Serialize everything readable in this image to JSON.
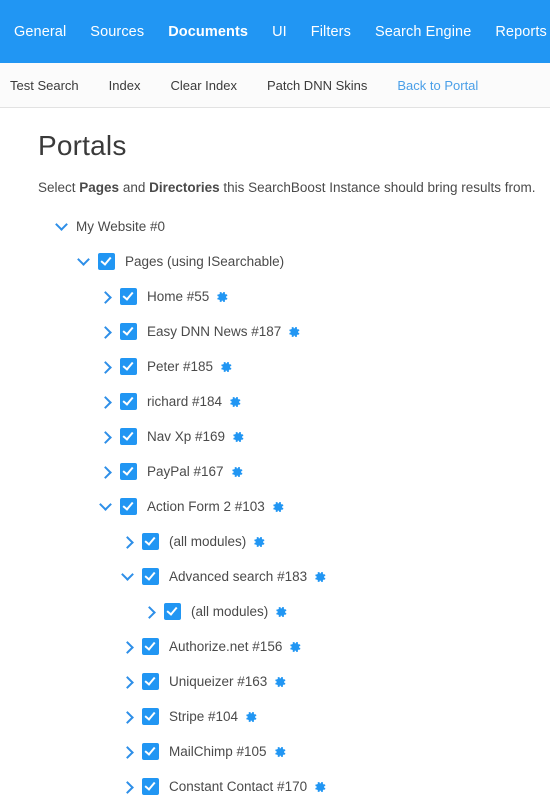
{
  "nav": {
    "items": [
      {
        "label": "General",
        "active": false
      },
      {
        "label": "Sources",
        "active": false
      },
      {
        "label": "Documents",
        "active": true
      },
      {
        "label": "UI",
        "active": false
      },
      {
        "label": "Filters",
        "active": false
      },
      {
        "label": "Search Engine",
        "active": false
      },
      {
        "label": "Reports",
        "active": false
      }
    ]
  },
  "toolbar": {
    "items": [
      {
        "label": "Test Search",
        "link": false
      },
      {
        "label": "Index",
        "link": false
      },
      {
        "label": "Clear Index",
        "link": false
      },
      {
        "label": "Patch DNN Skins",
        "link": false
      },
      {
        "label": "Back to Portal",
        "link": true
      }
    ]
  },
  "page": {
    "title": "Portals",
    "description_parts": [
      {
        "text": "Select ",
        "bold": false
      },
      {
        "text": "Pages",
        "bold": true
      },
      {
        "text": " and ",
        "bold": false
      },
      {
        "text": "Directories",
        "bold": true
      },
      {
        "text": " this SearchBoost Instance should bring results from.",
        "bold": false
      }
    ]
  },
  "colors": {
    "accent": "#2196f3",
    "nav_bg": "#2196f3",
    "link": "#4a9fe8",
    "text": "#4a4a4a",
    "toolbar_bg": "#fbfbfb"
  },
  "tree": {
    "nodes": [
      {
        "label": "My Website #0",
        "level": 0,
        "chevron": "down",
        "checkbox": false,
        "checked": false,
        "gear": false
      },
      {
        "label": "Pages (using ISearchable)",
        "level": 1,
        "chevron": "down",
        "checkbox": true,
        "checked": true,
        "gear": false
      },
      {
        "label": "Home #55",
        "level": 2,
        "chevron": "right",
        "checkbox": true,
        "checked": true,
        "gear": true
      },
      {
        "label": "Easy DNN News #187",
        "level": 2,
        "chevron": "right",
        "checkbox": true,
        "checked": true,
        "gear": true
      },
      {
        "label": "Peter #185",
        "level": 2,
        "chevron": "right",
        "checkbox": true,
        "checked": true,
        "gear": true
      },
      {
        "label": "richard #184",
        "level": 2,
        "chevron": "right",
        "checkbox": true,
        "checked": true,
        "gear": true
      },
      {
        "label": "Nav Xp #169",
        "level": 2,
        "chevron": "right",
        "checkbox": true,
        "checked": true,
        "gear": true
      },
      {
        "label": "PayPal #167",
        "level": 2,
        "chevron": "right",
        "checkbox": true,
        "checked": true,
        "gear": true
      },
      {
        "label": "Action Form 2 #103",
        "level": 2,
        "chevron": "down",
        "checkbox": true,
        "checked": true,
        "gear": true
      },
      {
        "label": "(all modules)",
        "level": 3,
        "chevron": "right",
        "checkbox": true,
        "checked": true,
        "gear": true
      },
      {
        "label": "Advanced search #183",
        "level": 3,
        "chevron": "down",
        "checkbox": true,
        "checked": true,
        "gear": true
      },
      {
        "label": "(all modules)",
        "level": 4,
        "chevron": "right",
        "checkbox": true,
        "checked": true,
        "gear": true
      },
      {
        "label": "Authorize.net #156",
        "level": 3,
        "chevron": "right",
        "checkbox": true,
        "checked": true,
        "gear": true
      },
      {
        "label": "Uniqueizer #163",
        "level": 3,
        "chevron": "right",
        "checkbox": true,
        "checked": true,
        "gear": true
      },
      {
        "label": "Stripe #104",
        "level": 3,
        "chevron": "right",
        "checkbox": true,
        "checked": true,
        "gear": true
      },
      {
        "label": "MailChimp #105",
        "level": 3,
        "chevron": "right",
        "checkbox": true,
        "checked": true,
        "gear": true
      },
      {
        "label": "Constant Contact #170",
        "level": 3,
        "chevron": "right",
        "checkbox": true,
        "checked": true,
        "gear": true
      }
    ],
    "indent_base": 18,
    "indent_step": 22
  }
}
